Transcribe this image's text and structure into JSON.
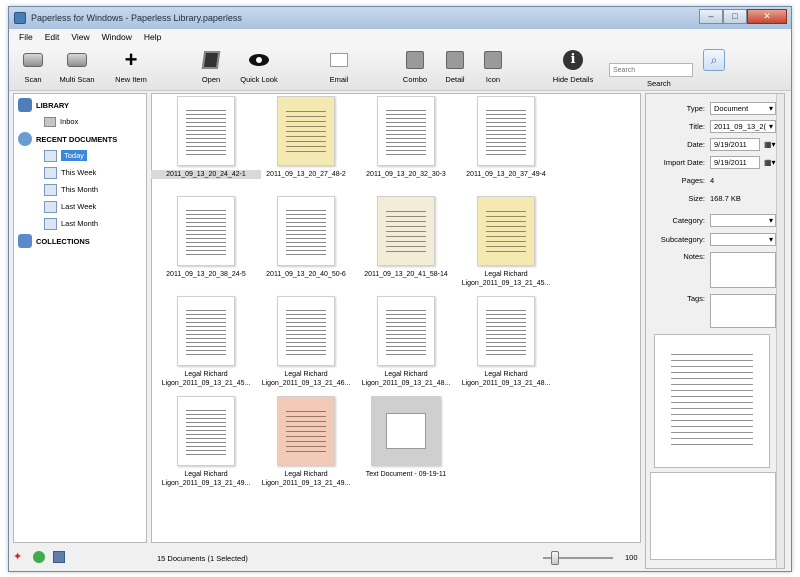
{
  "window": {
    "title": "Paperless for Windows - Paperless Library.paperless",
    "minimize": "–",
    "maximize": "□",
    "close": "✕"
  },
  "menu": [
    "File",
    "Edit",
    "View",
    "Window",
    "Help"
  ],
  "toolbar": {
    "scan": "Scan",
    "multi_scan": "Multi Scan",
    "new_item": "New Item",
    "open": "Open",
    "quick_look": "Quick Look",
    "email": "Email",
    "combo": "Combo",
    "detail": "Detail",
    "icon": "Icon",
    "hide_details": "Hide Details",
    "search_placeholder": "Search",
    "search_label": "Search"
  },
  "sidebar": {
    "library": "LIBRARY",
    "inbox": "Inbox",
    "recent_documents": "RECENT DOCUMENTS",
    "recent_items": [
      "Today",
      "This Week",
      "This Month",
      "Last Week",
      "Last Month"
    ],
    "collections": "COLLECTIONS"
  },
  "documents": [
    {
      "label": "2011_09_13_20_24_42-1",
      "color": "white"
    },
    {
      "label": "2011_09_13_20_27_48-2",
      "color": "yellow"
    },
    {
      "label": "2011_09_13_20_32_30-3",
      "color": "white"
    },
    {
      "label": "2011_09_13_20_37_49-4",
      "color": "white"
    },
    {
      "label": "2011_09_13_20_38_24-5",
      "color": "white"
    },
    {
      "label": "2011_09_13_20_40_50-6",
      "color": "white"
    },
    {
      "label": "2011_09_13_20_41_58-14",
      "color": "tan"
    },
    {
      "label": "Legal Richard Ligon_2011_09_13_21_45...",
      "color": "yellow"
    },
    {
      "label": "Legal Richard Ligon_2011_09_13_21_45...",
      "color": "white"
    },
    {
      "label": "Legal Richard Ligon_2011_09_13_21_46...",
      "color": "white"
    },
    {
      "label": "Legal Richard Ligon_2011_09_13_21_48...",
      "color": "white"
    },
    {
      "label": "Legal Richard Ligon_2011_09_13_21_48...",
      "color": "white"
    },
    {
      "label": "Legal Richard Ligon_2011_09_13_21_49...",
      "color": "white"
    },
    {
      "label": "Legal Richard Ligon_2011_09_13_21_49...",
      "color": "pink"
    },
    {
      "label": "Text Document - 09-19-11",
      "color": "gray"
    }
  ],
  "status": {
    "count": "15 Documents (1 Selected)",
    "zoom": "100"
  },
  "details": {
    "type_label": "Type:",
    "type_value": "Document",
    "title_label": "Title:",
    "title_value": "2011_09_13_2(",
    "date_label": "Date:",
    "date_value": "9/19/2011",
    "import_date_label": "Import Date:",
    "import_date_value": "9/19/2011",
    "pages_label": "Pages:",
    "pages_value": "4",
    "size_label": "Size:",
    "size_value": "168.7 KB",
    "category_label": "Category:",
    "subcategory_label": "Subcategory:",
    "notes_label": "Notes:",
    "tags_label": "Tags:"
  }
}
